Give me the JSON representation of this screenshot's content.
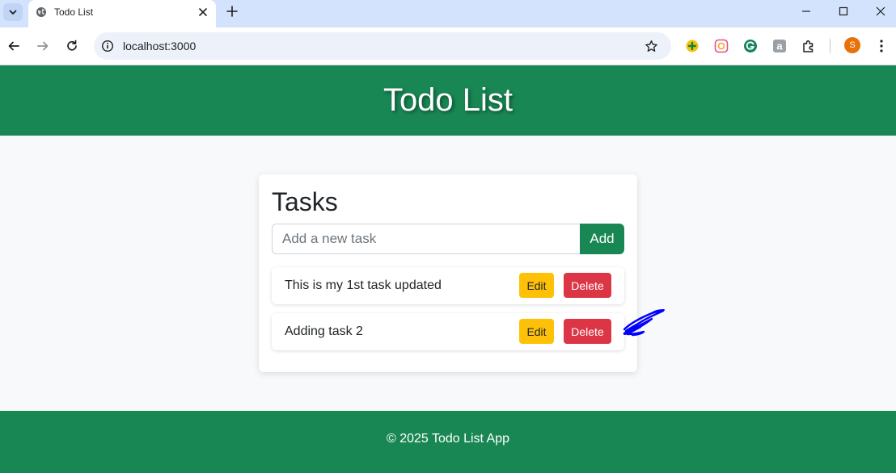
{
  "browser": {
    "tab_title": "Todo List",
    "url": "localhost:3000",
    "profile_initial": "S",
    "icons": {
      "tab_search": "chevron-down-icon",
      "favicon": "globe-icon",
      "tab_close": "close-icon",
      "new_tab": "plus-icon",
      "minimize": "minimize-icon",
      "maximize": "maximize-icon",
      "window_close": "close-icon",
      "back": "arrow-left-icon",
      "forward": "arrow-right-icon",
      "reload": "reload-icon",
      "site_info": "info-icon",
      "bookmark": "star-icon",
      "extensions": [
        "extension-puzzle-icon",
        "extension-camera-icon",
        "grammarly-icon",
        "amazon-icon",
        "extensions-menu-icon"
      ],
      "menu": "more-vertical-icon"
    }
  },
  "header": {
    "title": "Todo List"
  },
  "tasks_card": {
    "title": "Tasks",
    "input_placeholder": "Add a new task",
    "input_value": "",
    "add_label": "Add",
    "tasks": [
      {
        "text": "This is my 1st task updated",
        "edit_label": "Edit",
        "delete_label": "Delete"
      },
      {
        "text": "Adding task 2",
        "edit_label": "Edit",
        "delete_label": "Delete"
      }
    ]
  },
  "footer": {
    "text": "© 2025 Todo List App"
  },
  "colors": {
    "primary": "#198754",
    "warning": "#ffc107",
    "danger": "#dc3545",
    "background": "#f8f9fa",
    "annotation": "#0000ff"
  }
}
